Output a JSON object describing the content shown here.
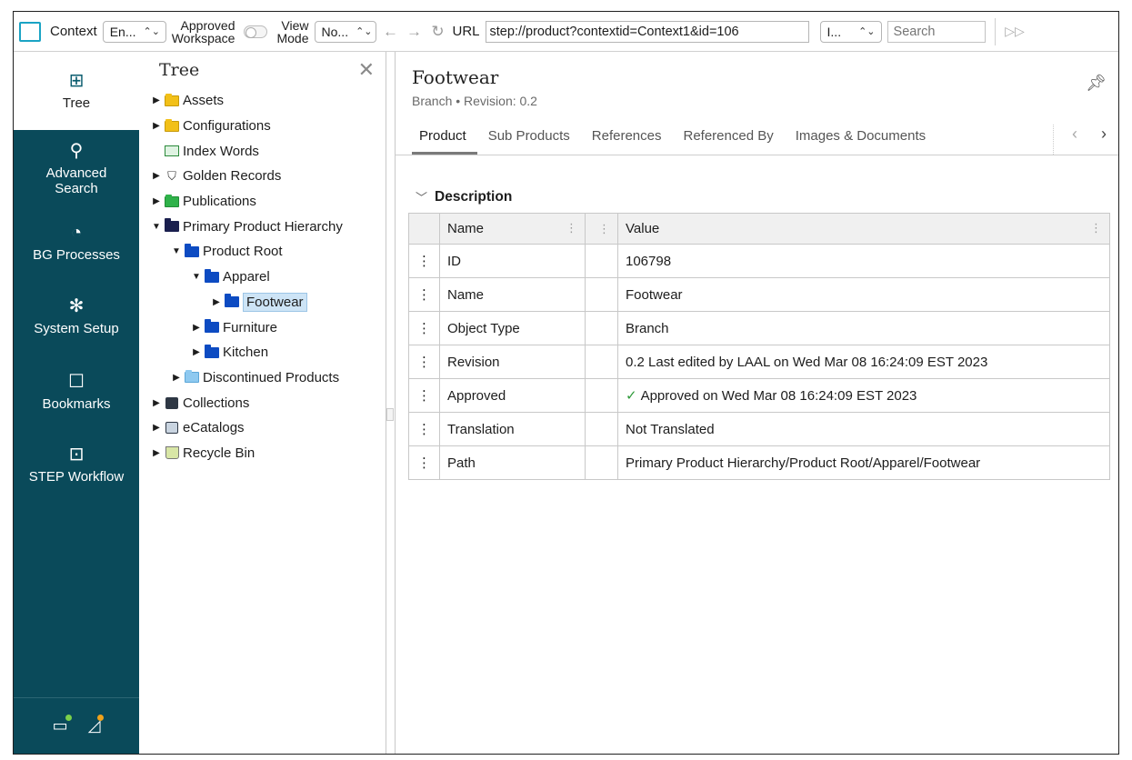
{
  "toolbar": {
    "context_label": "Context",
    "context_value": "En...",
    "approved_workspace_label_1": "Approved",
    "approved_workspace_label_2": "Workspace",
    "view_mode_label_1": "View",
    "view_mode_label_2": "Mode",
    "view_mode_value": "No...",
    "url_label": "URL",
    "url_value": "step://product?contextid=Context1&id=106",
    "lang_value": "I...",
    "search_placeholder": "Search"
  },
  "sidebar": {
    "items": [
      {
        "label": "Tree",
        "icon": "tree-icon",
        "active": true
      },
      {
        "label": "Advanced Search",
        "icon": "search-icon"
      },
      {
        "label": "BG Processes",
        "icon": "bg-processes-icon"
      },
      {
        "label": "System Setup",
        "icon": "gear-icon"
      },
      {
        "label": "Bookmarks",
        "icon": "bookmark-icon"
      },
      {
        "label": "STEP Workflow",
        "icon": "workflow-icon"
      }
    ]
  },
  "tree": {
    "title": "Tree",
    "nodes": [
      {
        "label": "Assets"
      },
      {
        "label": "Configurations"
      },
      {
        "label": "Index Words"
      },
      {
        "label": "Golden Records"
      },
      {
        "label": "Publications"
      },
      {
        "label": "Primary Product Hierarchy"
      },
      {
        "label": "Product Root"
      },
      {
        "label": "Apparel"
      },
      {
        "label": "Footwear"
      },
      {
        "label": "Furniture"
      },
      {
        "label": "Kitchen"
      },
      {
        "label": "Discontinued Products"
      },
      {
        "label": "Collections"
      },
      {
        "label": "eCatalogs"
      },
      {
        "label": "Recycle Bin"
      }
    ]
  },
  "main": {
    "title": "Footwear",
    "subtitle": "Branch • Revision: 0.2",
    "tabs": [
      {
        "label": "Product",
        "active": true
      },
      {
        "label": "Sub Products"
      },
      {
        "label": "References"
      },
      {
        "label": "Referenced By"
      },
      {
        "label": "Images & Documents"
      }
    ],
    "section_title": "Description",
    "table": {
      "headers": {
        "name": "Name",
        "value": "Value"
      },
      "rows": [
        {
          "name": "ID",
          "value": "106798"
        },
        {
          "name": "Name",
          "value": "Footwear"
        },
        {
          "name": "Object Type",
          "value": "Branch"
        },
        {
          "name": "Revision",
          "value": "0.2 Last edited by LAAL on Wed Mar 08 16:24:09 EST 2023"
        },
        {
          "name": "Approved",
          "value": "Approved on Wed Mar 08 16:24:09 EST 2023"
        },
        {
          "name": "Translation",
          "value": "Not Translated"
        },
        {
          "name": "Path",
          "value": "Primary Product Hierarchy/Product Root/Apparel/Footwear"
        }
      ]
    }
  },
  "colors": {
    "sidebar_bg": "#0a4a5a",
    "accent": "#1aa3c4",
    "selected_bg": "#cde4f6",
    "approved_check": "#2f9a3a"
  }
}
